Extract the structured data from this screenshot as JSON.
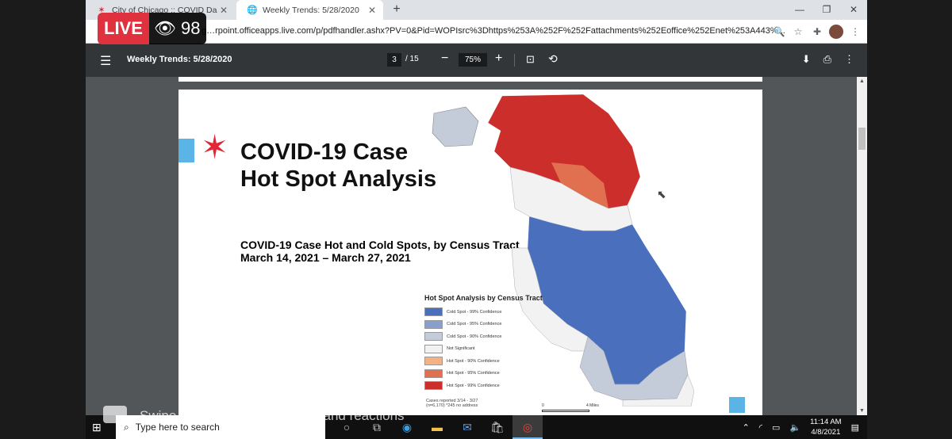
{
  "overlay": {
    "live_label": "LIVE",
    "viewer_count": "98",
    "comment_hint": "Swipe left to reveal comments and reactions"
  },
  "browser": {
    "tabs": [
      {
        "title": "City of Chicago :: COVID Dashbo",
        "icon": "chicago-star-icon"
      },
      {
        "title": "Weekly Trends: 5/28/2020",
        "icon": "globe-icon"
      }
    ],
    "new_tab": "+",
    "url": "g…rpoint.officeapps.live.com/p/pdfhandler.ashx?PV=0&Pid=WOPIsrc%3Dhttps%253A%252F%252Fattachments%252Eoffice%252Enet%253A443%...",
    "window_controls": [
      "—",
      "❐",
      "✕"
    ]
  },
  "pdf_toolbar": {
    "title": "Weekly Trends: 5/28/2020",
    "current_page": "3",
    "total_pages": "/ 15",
    "zoom": "75%"
  },
  "slide": {
    "heading_line1": "COVID-19 Case",
    "heading_line2": "Hot Spot Analysis",
    "subheading_line1": "COVID-19 Case Hot and Cold Spots, by Census Tract",
    "subheading_line2": "March 14, 2021 – March 27, 2021",
    "legend_title": "Hot Spot Analysis by Census Tract",
    "legend": [
      {
        "label": "Cold Spot - 99% Confidence",
        "color": "#4a6fbd"
      },
      {
        "label": "Cold Spot - 95% Confidence",
        "color": "#8aa0cc"
      },
      {
        "label": "Cold Spot - 90% Confidence",
        "color": "#c4ccd9"
      },
      {
        "label": "Not Significant",
        "color": "#f2f2f2"
      },
      {
        "label": "Hot Spot - 90% Confidence",
        "color": "#f3b184"
      },
      {
        "label": "Hot Spot - 95% Confidence",
        "color": "#e0704f"
      },
      {
        "label": "Hot Spot - 99% Confidence",
        "color": "#cc2e2b"
      }
    ],
    "note_line1": "Cases reported 3/14 - 3/27",
    "note_line2": "(n=6,170)  *245 no address",
    "scale_zero": "0",
    "scale_max": "4 Miles"
  },
  "taskbar": {
    "search_placeholder": "Type here to search",
    "time": "11:14 AM",
    "date": "4/8/2021"
  }
}
